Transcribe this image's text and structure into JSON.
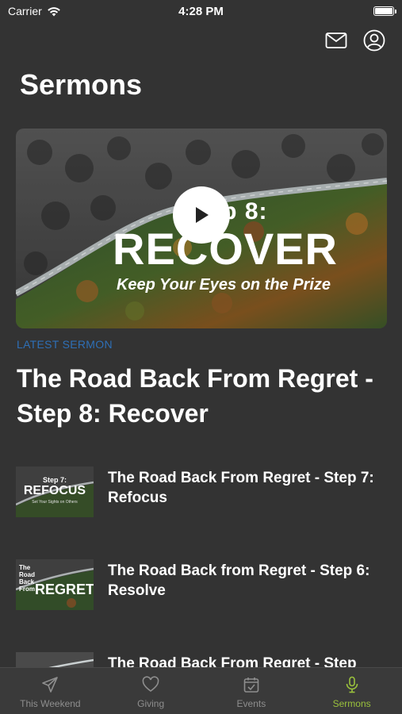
{
  "status_bar": {
    "carrier": "Carrier",
    "time": "4:28 PM"
  },
  "header": {
    "title": "Sermons",
    "mail_icon": "mail-icon",
    "account_icon": "account-circle-icon"
  },
  "hero": {
    "step_text": "Step 8:",
    "big_text": "RECOVER",
    "subtitle": "Keep Your Eyes on the Prize",
    "play_icon": "play-icon"
  },
  "latest": {
    "label": "LATEST SERMON",
    "title": "The Road Back From Regret - Step 8: Recover"
  },
  "sermons": [
    {
      "title": "The Road Back From Regret - Step 7: Refocus",
      "thumb_step": "Step 7:",
      "thumb_big": "REFOCUS",
      "thumb_sub": "Set Your Sights on Others"
    },
    {
      "title": "The Road Back from Regret - Step 6: Resolve",
      "thumb_side": "The Road Back From",
      "thumb_big": "REGRET"
    },
    {
      "title": "The Road Back From Regret - Step"
    }
  ],
  "tabs": [
    {
      "label": "This Weekend",
      "icon": "paper-plane-icon"
    },
    {
      "label": "Giving",
      "icon": "heart-icon"
    },
    {
      "label": "Events",
      "icon": "calendar-check-icon"
    },
    {
      "label": "Sermons",
      "icon": "microphone-icon",
      "active": true
    }
  ],
  "colors": {
    "background": "#333333",
    "accent_blue": "#2e6fb6",
    "active_tab": "#9ac13c",
    "inactive_tab": "#8e8e8e"
  }
}
